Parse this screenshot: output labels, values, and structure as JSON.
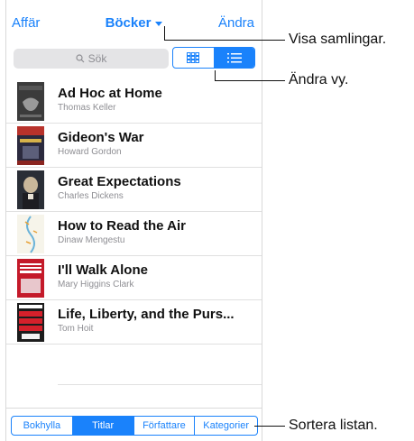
{
  "nav": {
    "left": "Affär",
    "center": "Böcker",
    "right": "Ändra"
  },
  "search": {
    "placeholder": "Sök"
  },
  "view_toggle": {
    "active": "list",
    "options": [
      "grid-icon",
      "list-icon"
    ]
  },
  "books": [
    {
      "title": "Ad Hoc at Home",
      "author": "Thomas Keller",
      "cover_text": "ad hoc at home"
    },
    {
      "title": "Gideon's War",
      "author": "Howard Gordon",
      "cover_text": ""
    },
    {
      "title": "Great Expectations",
      "author": "Charles Dickens",
      "cover_text": ""
    },
    {
      "title": "How to Read the Air",
      "author": "Dinaw Mengestu",
      "cover_text": ""
    },
    {
      "title": "I'll Walk Alone",
      "author": "Mary Higgins Clark",
      "cover_text": "MARY HIGGINS CLARK"
    },
    {
      "title": "Life, Liberty, and the Purs...",
      "author": "Tom Hoit",
      "cover_text": "LIFE, LIBERTY"
    }
  ],
  "sort_tabs": {
    "items": [
      "Bokhylla",
      "Titlar",
      "Författare",
      "Kategorier"
    ],
    "active": "Titlar"
  },
  "callouts": {
    "collections": "Visa samlingar.",
    "change_view": "Ändra vy.",
    "sort": "Sortera listan."
  },
  "colors": {
    "accent": "#1a82fb"
  }
}
